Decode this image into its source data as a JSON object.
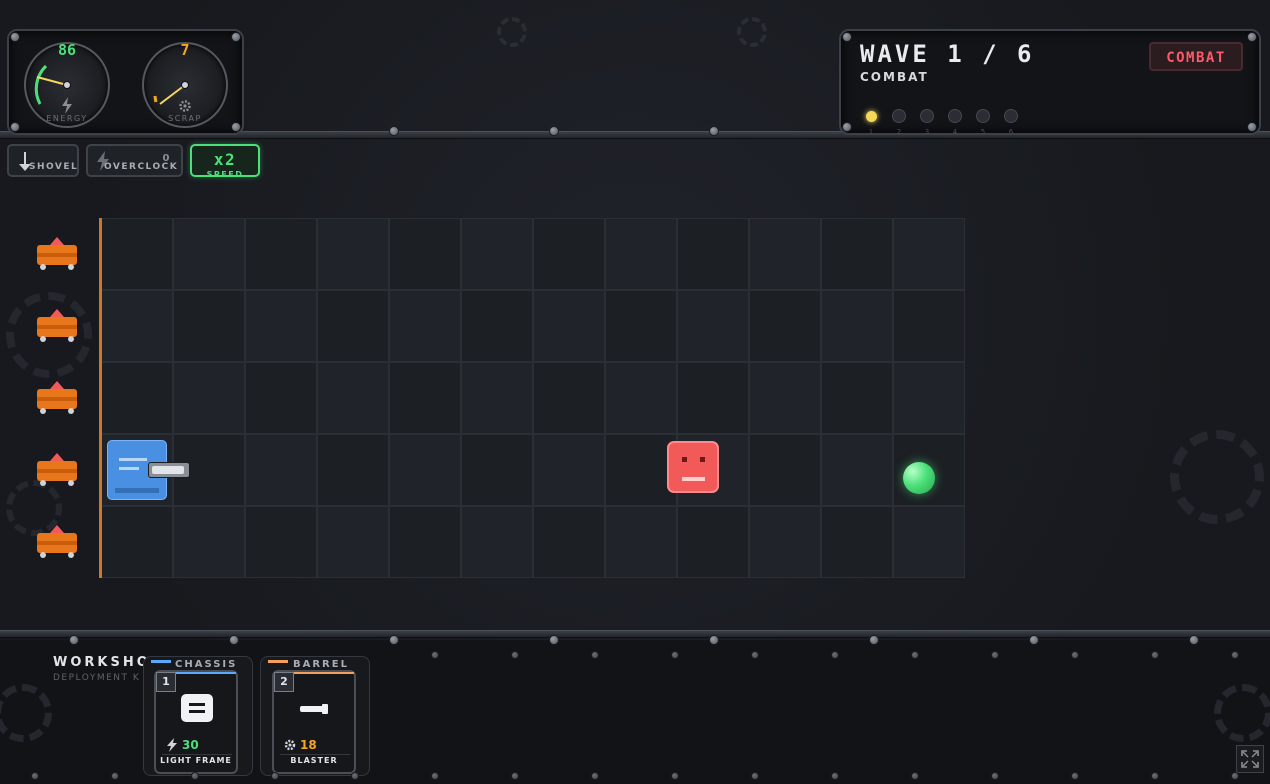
{
  "stats": {
    "energy": {
      "value": "86",
      "label": "ENERGY",
      "color": "#4be07a",
      "fraction": 0.86
    },
    "scrap": {
      "value": "7",
      "label": "SCRAP",
      "color": "#f5a623",
      "fraction": 0.07
    }
  },
  "wave": {
    "title": "WAVE 1 / 6",
    "phase": "COMBAT",
    "badge": "COMBAT",
    "dots": [
      "1",
      "2",
      "3",
      "4",
      "5",
      "6"
    ],
    "current": 1
  },
  "tools": {
    "shovel": "SHOVEL",
    "overclock": "OVERCLOCK",
    "overclock_count": "0",
    "speed": "x2",
    "speed_label": "SPEED"
  },
  "workshop": {
    "title": "WORKSHOP",
    "subtitle": "DEPLOYMENT K",
    "categories": [
      {
        "name": "CHASSIS",
        "accent": "#5aa9ff",
        "slot": "1",
        "cost": "30",
        "cost_type": "energy",
        "item": "LIGHT FRAME"
      },
      {
        "name": "BARREL",
        "accent": "#f5a05a",
        "slot": "2",
        "cost": "18",
        "cost_type": "scrap",
        "item": "BLASTER"
      }
    ]
  },
  "colors": {
    "energy": "#4be07a",
    "scrap": "#f5a623",
    "combat": "#ff5a6a",
    "robot": "#4a90e2",
    "enemy": "#f25a5a"
  }
}
